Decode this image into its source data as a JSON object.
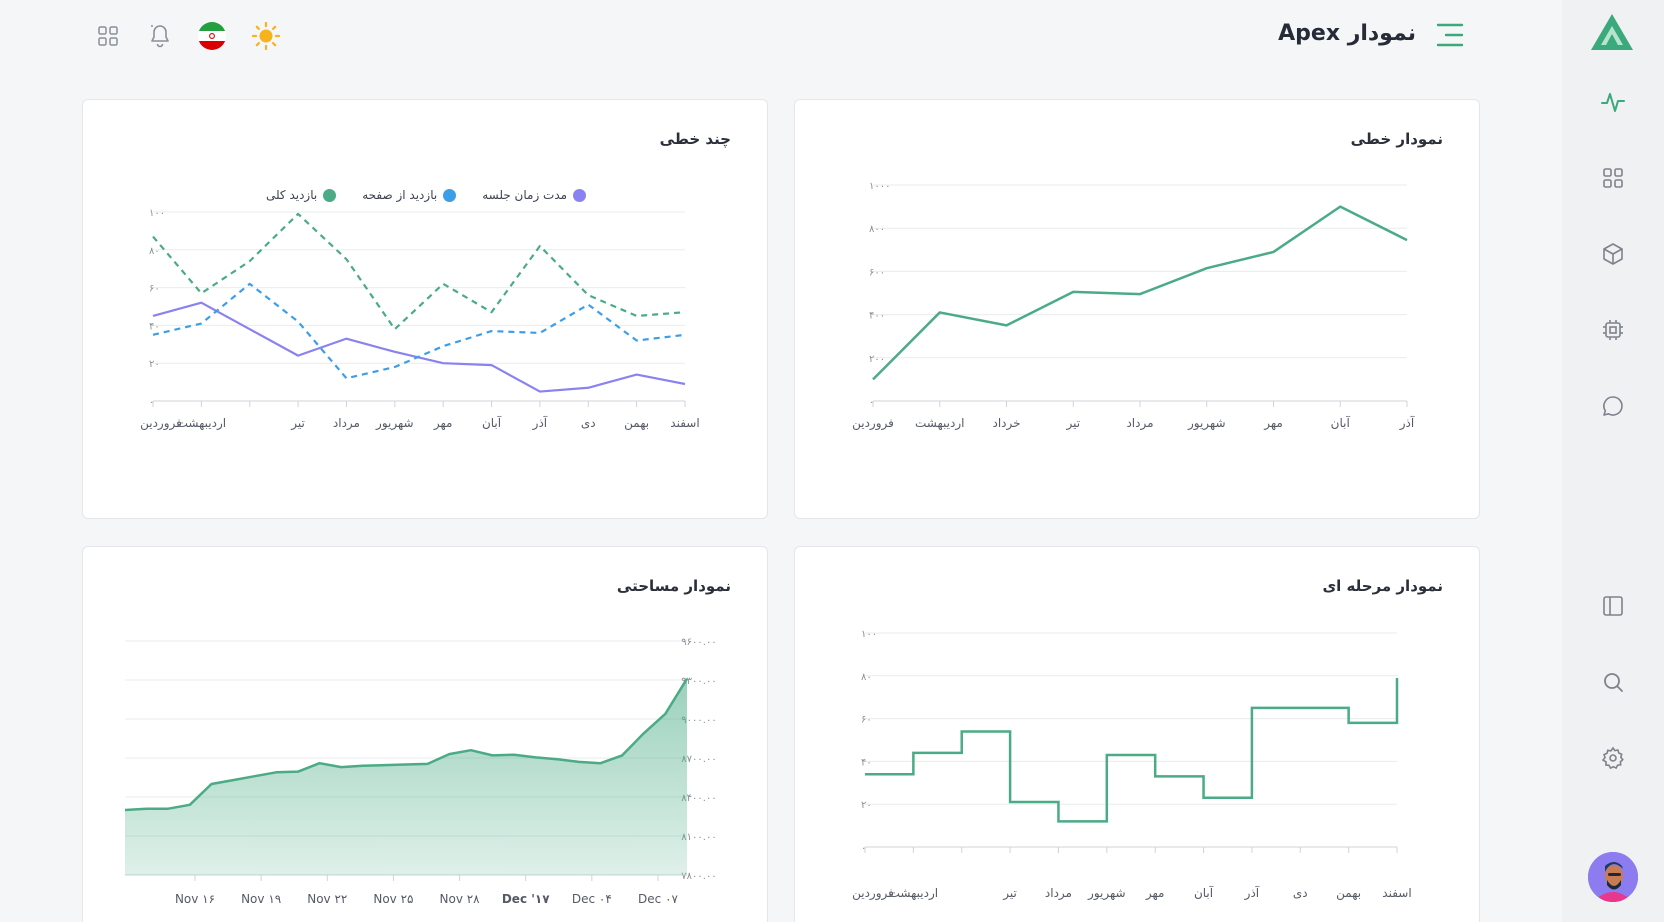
{
  "header": {
    "title": "نمودار Apex"
  },
  "icons": {
    "menu": "menu-toggle-icon",
    "apps": "apps-grid-icon",
    "bell": "bell-icon",
    "flag": "iran-flag-icon",
    "theme": "sun-icon"
  },
  "rail": {
    "items": [
      "activity-icon",
      "dashboard-icon",
      "cube-icon",
      "chip-icon",
      "chat-icon",
      "layout-icon",
      "search-icon",
      "settings-icon"
    ],
    "accent": "#3aa97b"
  },
  "colors": {
    "green": "#4aab86",
    "blue": "#3d9ee8",
    "purple": "#8a82f0"
  },
  "cards": {
    "line": {
      "title": "نمودار خطی"
    },
    "multi": {
      "title": "چند خطی"
    },
    "step": {
      "title": "نمودار مرحله ای"
    },
    "area": {
      "title": "نمودار مساحتی"
    }
  },
  "chart_data": [
    {
      "id": "line",
      "type": "line",
      "title": "نمودار خطی",
      "categories": [
        "فروردین",
        "اردیبهشت",
        "خرداد",
        "تیر",
        "مرداد",
        "شهریور",
        "مهر",
        "آبان",
        "آذر"
      ],
      "series": [
        {
          "values": [
            100,
            410,
            350,
            505,
            495,
            615,
            690,
            900,
            745
          ]
        }
      ],
      "yticks": [
        "۰",
        "۲۰۰",
        "۴۰۰",
        "۶۰۰",
        "۸۰۰",
        "۱۰۰۰"
      ],
      "ylim": [
        0,
        1000
      ],
      "grid": true
    },
    {
      "id": "multi",
      "type": "line",
      "title": "چند خطی",
      "categories": [
        "فروردین",
        "اردیبهشت",
        "",
        "تیر",
        "مرداد",
        "شهریور",
        "مهر",
        "آبان",
        "آذر",
        "دی",
        "بهمن",
        "اسفند"
      ],
      "series": [
        {
          "name": "مدت زمان جلسه",
          "style": "solid",
          "values": [
            45,
            52,
            38,
            24,
            33,
            26,
            20,
            19,
            5,
            7,
            14,
            9
          ]
        },
        {
          "name": "بازدید از صفحه",
          "style": "dashed",
          "values": [
            35,
            41,
            62,
            42,
            12,
            18,
            29,
            37,
            36,
            51,
            32,
            35
          ]
        },
        {
          "name": "بازدید کلی",
          "style": "dashed",
          "values": [
            87,
            57,
            74,
            99,
            75,
            38,
            62,
            47,
            82,
            56,
            45,
            47
          ]
        }
      ],
      "yticks": [
        "۰",
        "۲۰",
        "۴۰",
        "۶۰",
        "۸۰",
        "۱۰۰"
      ],
      "ylim": [
        0,
        100
      ],
      "legend": "top-center",
      "grid": true
    },
    {
      "id": "step",
      "type": "line",
      "title": "نمودار مرحله ای",
      "categories": [
        "فروردین",
        "اردیبهشت",
        "",
        "تیر",
        "مرداد",
        "شهریور",
        "مهر",
        "آبان",
        "آذر",
        "دی",
        "بهمن",
        "اسفند"
      ],
      "series": [
        {
          "values": [
            34,
            44,
            54,
            21,
            12,
            43,
            33,
            23,
            65,
            65,
            58,
            79
          ]
        }
      ],
      "yticks": [
        "۰",
        "۲۰",
        "۴۰",
        "۶۰",
        "۸۰",
        "۱۰۰"
      ],
      "ylim": [
        0,
        100
      ],
      "grid": true
    },
    {
      "id": "area",
      "type": "area",
      "title": "نمودار مساحتی",
      "x": [
        "Nov ۱۶",
        "Nov ۱۹",
        "Nov ۲۲",
        "Nov ۲۵",
        "Nov ۲۸",
        "Dec '۱۷",
        "Dec ۰۴",
        "Dec ۰۷"
      ],
      "series": [
        {
          "values": [
            8300,
            8310,
            8310,
            8340,
            8500,
            8530,
            8560,
            8590,
            8595,
            8660,
            8630,
            8640,
            8645,
            8650,
            8655,
            8730,
            8760,
            8720,
            8725,
            8705,
            8690,
            8670,
            8660,
            8720,
            8890,
            9040,
            9310
          ]
        }
      ],
      "yticks": [
        "۷۸۰۰.۰۰",
        "۸۱۰۰.۰۰",
        "۸۴۰۰.۰۰",
        "۸۷۰۰.۰۰",
        "۹۰۰۰.۰۰",
        "۹۳۰۰.۰۰",
        "۹۶۰۰.۰۰"
      ],
      "ylim": [
        7800,
        9600
      ],
      "grid": true
    }
  ]
}
